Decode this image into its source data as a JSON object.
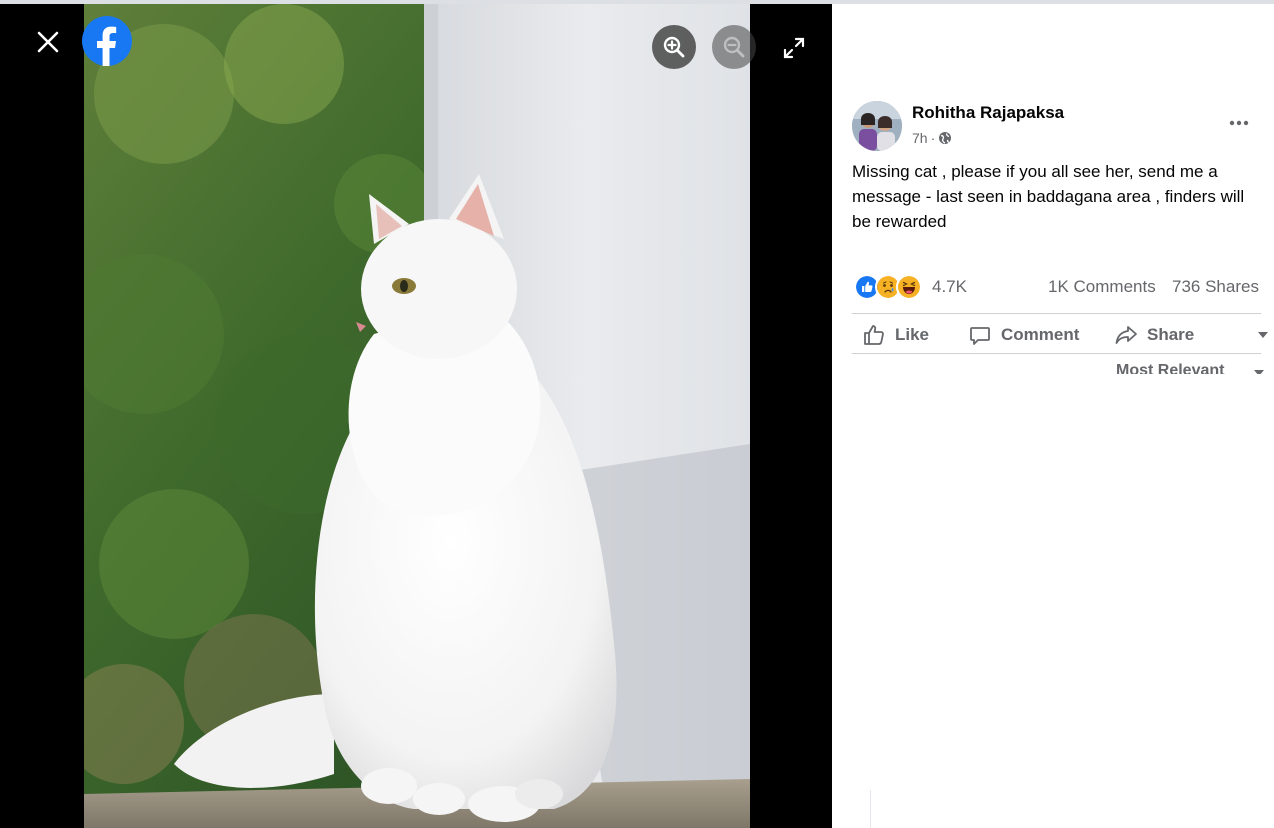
{
  "post": {
    "author": "Rohitha Rajapaksa",
    "time": "7h",
    "separator": "·",
    "text": "Missing cat , please if you all see her, send me a message - last seen in baddagana area , finders will be rewarded",
    "reactions_count": "4.7K",
    "comments_count": "1K Comments",
    "shares_count": "736 Shares"
  },
  "reactions": [
    "like-icon",
    "sad-icon",
    "haha-icon"
  ],
  "actions": {
    "like": "Like",
    "comment": "Comment",
    "share": "Share"
  },
  "comments_sort": "Most Relevant",
  "viewer": {
    "icons": [
      "close-icon",
      "facebook-logo",
      "zoom-in-icon",
      "zoom-out-icon",
      "expand-icon"
    ]
  },
  "colors": {
    "facebook_blue": "#1877f2",
    "text_primary": "#050505",
    "text_secondary": "#65676b",
    "viewer_background": "#000000"
  }
}
